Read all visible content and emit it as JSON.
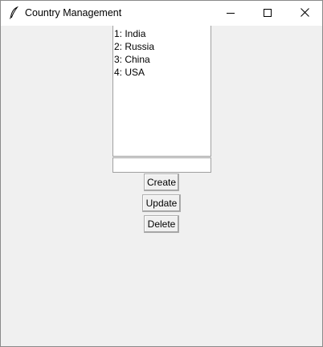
{
  "window": {
    "title": "Country Management",
    "icon": "feather-icon",
    "controls": [
      "minimize-icon",
      "maximize-icon",
      "close-icon"
    ]
  },
  "countries": {
    "items": [
      {
        "label": "1: India"
      },
      {
        "label": "2: Russia"
      },
      {
        "label": "3: China"
      },
      {
        "label": "4: USA"
      }
    ]
  },
  "entry": {
    "value": ""
  },
  "buttons": {
    "create": "Create",
    "update": "Update",
    "delete": "Delete"
  }
}
